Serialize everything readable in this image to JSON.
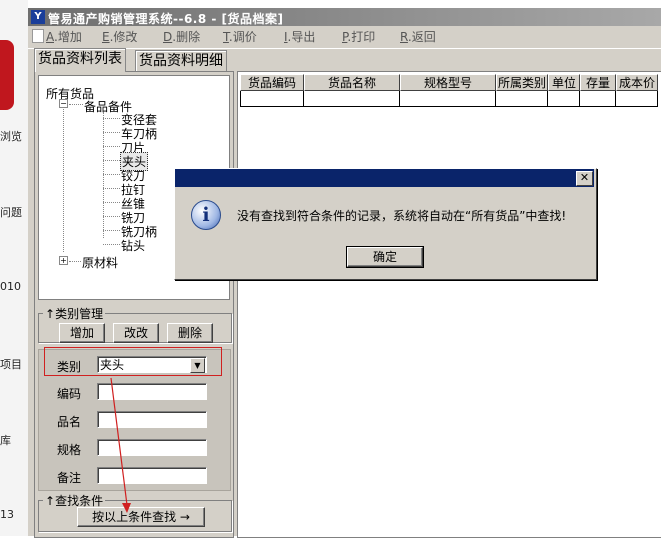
{
  "window": {
    "title": "管易通产购销管理系统--6.8 - [货品档案]"
  },
  "toolbar": [
    {
      "key": "A",
      "label": ".增加"
    },
    {
      "key": "E",
      "label": ".修改"
    },
    {
      "key": "D",
      "label": ".删除"
    },
    {
      "key": "T",
      "label": ".调价"
    },
    {
      "key": "I",
      "label": ".导出"
    },
    {
      "key": "P",
      "label": ".打印"
    },
    {
      "key": "R",
      "label": ".返回"
    }
  ],
  "tabs": [
    "货品资料列表",
    "货品资料明细"
  ],
  "tree": {
    "root": "所有货品",
    "group1": "备品备件",
    "children": [
      "变径套",
      "车刀柄",
      "刀片",
      "夹头",
      "铰刀",
      "拉钉",
      "丝锥",
      "铣刀",
      "铣刀柄",
      "钻头"
    ],
    "selected": "夹头",
    "group2": "原材料"
  },
  "category_mgmt": {
    "legend": "类别管理",
    "add": "增加",
    "edit": "改改",
    "delete": "删除"
  },
  "filters": {
    "category_label": "类别",
    "category_value": "夹头",
    "code_label": "编码",
    "name_label": "品名",
    "spec_label": "规格",
    "note_label": "备注"
  },
  "search": {
    "legend": "查找条件",
    "button": "按以上条件查找 →"
  },
  "grid": {
    "columns": [
      "货品编码",
      "货品名称",
      "规格型号",
      "所属类别",
      "单位",
      "存量",
      "成本价"
    ]
  },
  "dialog": {
    "message": "没有查找到符合条件的记录，系统将自动在“所有货品”中查找!",
    "ok": "确定"
  },
  "desktop_labels": [
    "浏览",
    "问题",
    "010",
    "项目",
    "库",
    "13"
  ]
}
